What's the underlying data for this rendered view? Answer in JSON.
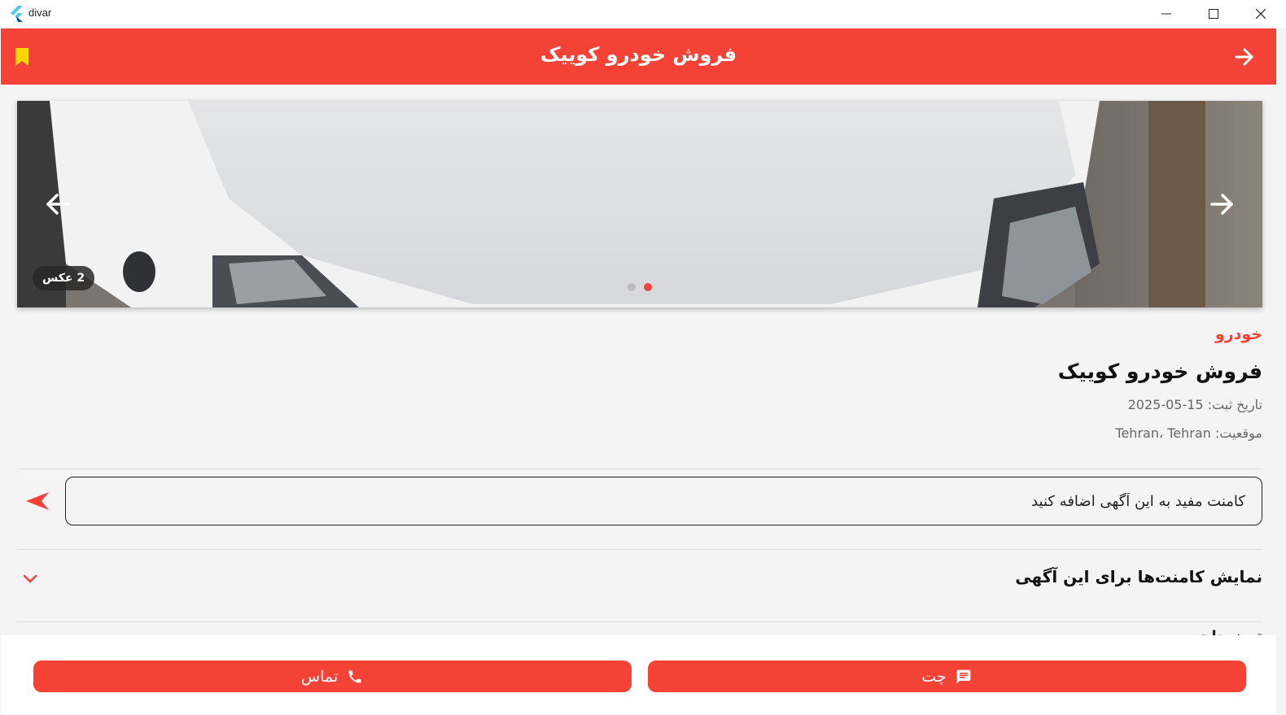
{
  "window": {
    "app_name": "divar",
    "controls": [
      "minimize-icon",
      "maximize-icon",
      "close-icon"
    ]
  },
  "appbar": {
    "title": "فروش خودرو کوییک",
    "back_icon": "arrow-right-icon",
    "bookmark_icon": "bookmark-icon"
  },
  "carousel": {
    "photo_count": "2 عکس",
    "prev_icon": "arrow-left-icon",
    "next_icon": "arrow-right-icon",
    "total_pages": 2,
    "active_page": 2
  },
  "ad": {
    "category": "خودرو",
    "title": "فروش خودرو کوییک",
    "date_text": "تاریخ ثبت: 15-05-2025",
    "location_text": "موقعیت: Tehran، Tehran"
  },
  "comment": {
    "placeholder": "کامنت مفید به این آگهی اضافه کنید",
    "send_icon": "send-icon"
  },
  "comments_section": {
    "label": "نمایش کامنت‌ها برای این آگهی",
    "chevron_icon": "chevron-down-icon"
  },
  "partially_visible": {
    "text": "توضیحات"
  },
  "actions": {
    "call_label": "تماس",
    "call_icon": "phone-icon",
    "chat_label": "چت",
    "chat_icon": "chat-icon"
  },
  "colors": {
    "primary": "#f44336",
    "background": "#f4f4f4",
    "bookmark": "#ffd600"
  }
}
